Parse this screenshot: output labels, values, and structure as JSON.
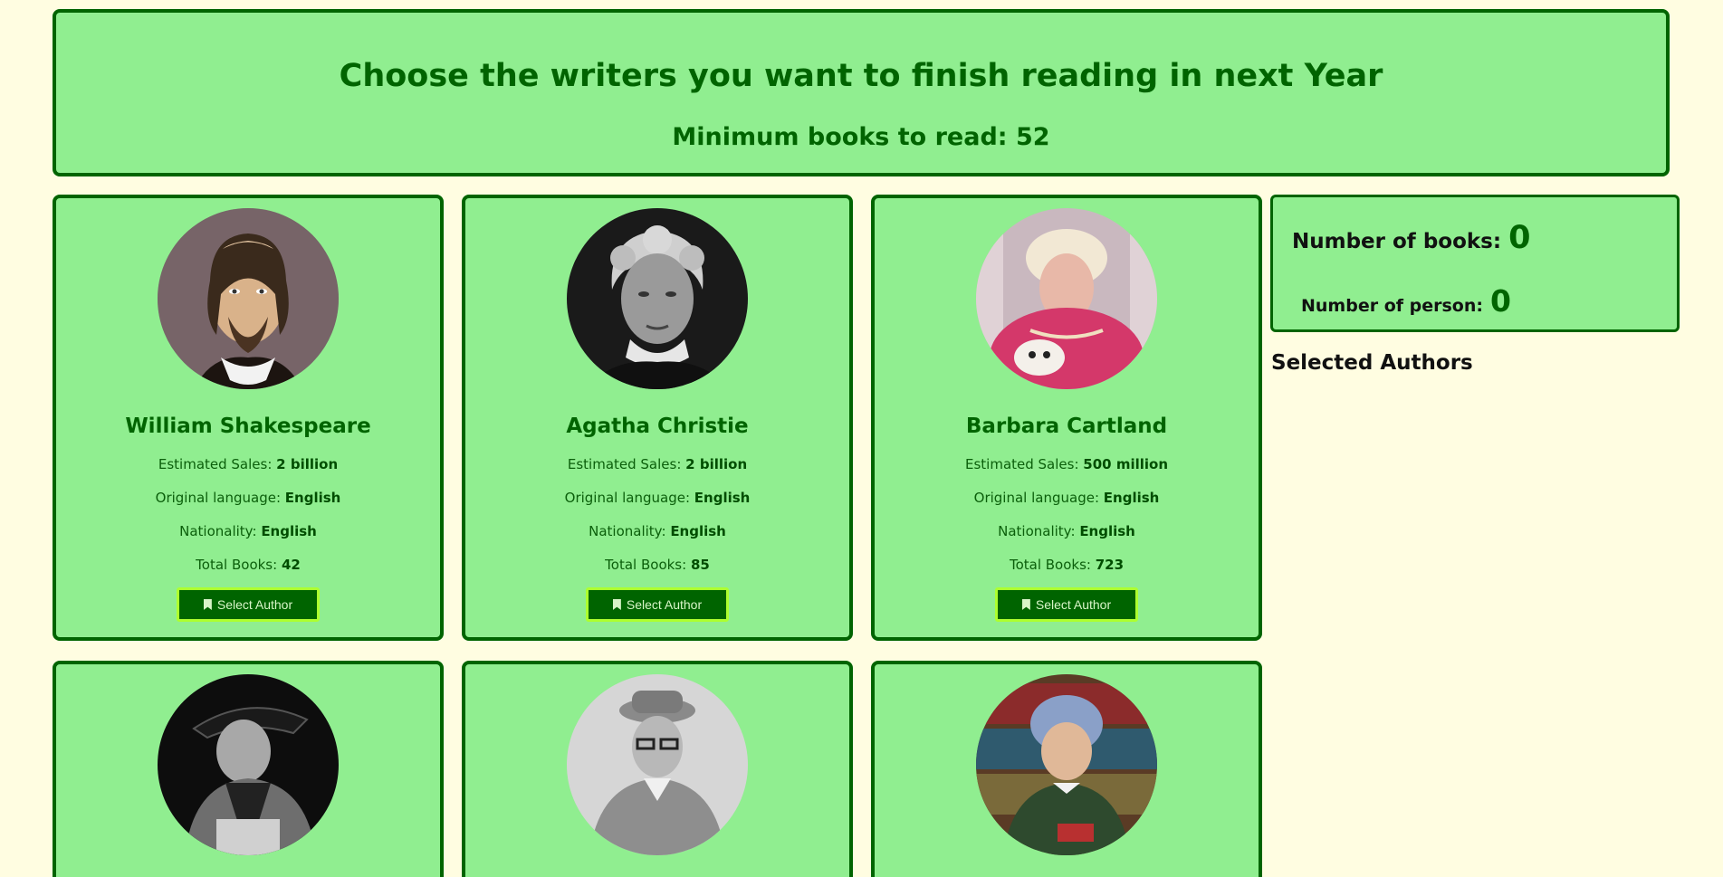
{
  "header": {
    "title": "Choose the writers you want to finish reading in next Year",
    "subtitle": "Minimum books to read: 52"
  },
  "stats": {
    "books_label": "Number of books:",
    "books_value": "0",
    "persons_label": "Number of person:",
    "persons_value": "0"
  },
  "selected": {
    "title": "Selected Authors"
  },
  "labels": {
    "sales": "Estimated Sales:",
    "language": "Original language:",
    "nationality": "Nationality:",
    "total": "Total Books:",
    "select_button": "Select Author"
  },
  "authors": [
    {
      "name": "William Shakespeare",
      "sales": "2 billion",
      "language": "English",
      "nationality": "English",
      "total": "42"
    },
    {
      "name": "Agatha Christie",
      "sales": "2 billion",
      "language": "English",
      "nationality": "English",
      "total": "85"
    },
    {
      "name": "Barbara Cartland",
      "sales": "500 million",
      "language": "English",
      "nationality": "English",
      "total": "723"
    }
  ],
  "colors": {
    "background": "#fffde1",
    "card": "#90ee90",
    "border": "#006400",
    "button_border": "#adff2f"
  }
}
